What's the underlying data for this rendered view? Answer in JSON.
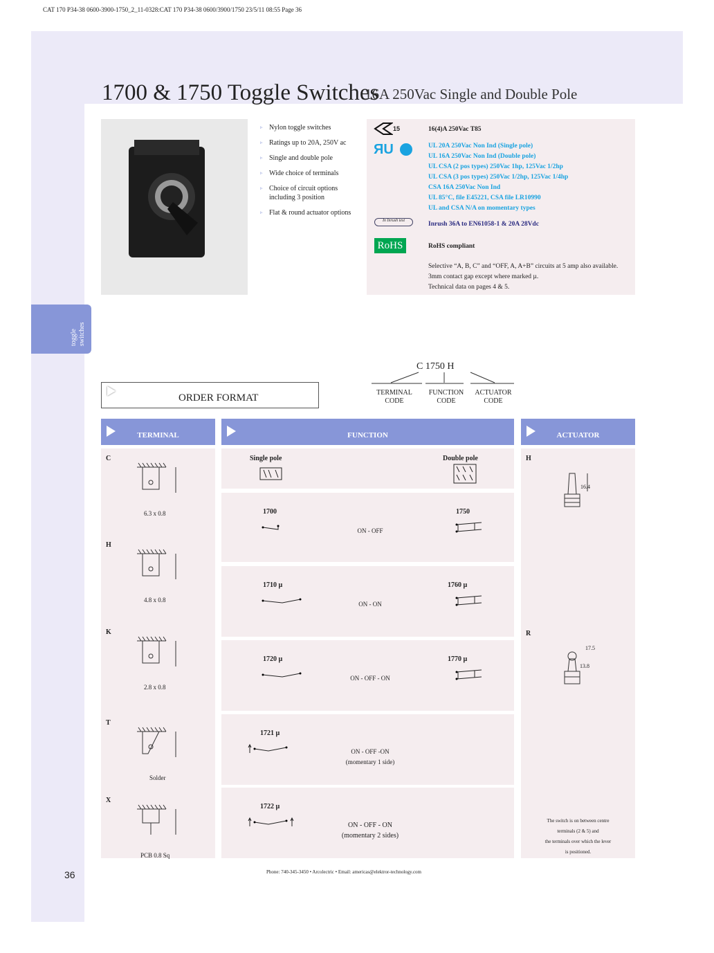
{
  "slug": "CAT 170 P34-38 0600-3900-1750_2_11-0328:CAT 170 P34-38 0600/3900/1750  23/5/11  08:55  Page 36",
  "title": "1700 & 1750 Toggle Switches",
  "subtitle": "16A 250Vac Single and Double Pole",
  "side_tab": [
    "toggle",
    "switches"
  ],
  "features": [
    "Nylon toggle switches",
    "Ratings up to 20A, 250V ac",
    "Single and double pole",
    "Wide choice of terminals",
    "Choice of circuit options including 3 position",
    "Flat & round actuator options"
  ],
  "certs": {
    "enec_num": "15",
    "enec": "16(4)A 250Vac  T85",
    "ul_lines": [
      "UL 20A 250Vac Non Ind (Single pole)",
      "UL 16A 250Vac Non Ind (Double pole)",
      "UL CSA (2 pos types) 250Vac 1hp, 125Vac 1/2hp",
      "UL CSA (3 pos types) 250Vac 1/2hp, 125Vac 1/4hp",
      "CSA 16A 250Vac Non Ind",
      "UL 85°C, file E45221, CSA file LR10990",
      "UL and CSA N/A on momentary types"
    ],
    "inrush_badge": "In Inrush test",
    "inrush": "Inrush 36A to EN61058-1 & 20A 28Vdc",
    "rohs_badge": "RoHS",
    "rohs": "RoHS compliant",
    "notes": [
      "Selective “A, B, C” and “OFF, A, A+B” circuits at 5 amp also available.",
      "3mm contact gap except where marked µ.",
      "Technical data on pages 4 & 5."
    ]
  },
  "order_format": {
    "label": "ORDER FORMAT",
    "code": "C 1750 H",
    "parts": [
      [
        "TERMINAL",
        "CODE"
      ],
      [
        "FUNCTION",
        "CODE"
      ],
      [
        "ACTUATOR",
        "CODE"
      ]
    ]
  },
  "headers": {
    "terminal": "TERMINAL",
    "function": "FUNCTION",
    "actuator": "ACTUATOR"
  },
  "terminals": [
    {
      "code": "C",
      "size": "6.3 x 0.8"
    },
    {
      "code": "H",
      "size": "4.8 x 0.8"
    },
    {
      "code": "K",
      "size": "2.8 x 0.8"
    },
    {
      "code": "T",
      "size": "Solder"
    },
    {
      "code": "X",
      "size": "PCB 0.8 Sq"
    }
  ],
  "function": {
    "single": "Single pole",
    "double": "Double pole",
    "rows": [
      {
        "sp": "1700",
        "dp": "1750",
        "desc": "ON - OFF",
        "sub": ""
      },
      {
        "sp": "1710 µ",
        "dp": "1760 µ",
        "desc": "ON - ON",
        "sub": ""
      },
      {
        "sp": "1720 µ",
        "dp": "1770 µ",
        "desc": "ON - OFF - ON",
        "sub": ""
      },
      {
        "sp": "1721 µ",
        "dp": "",
        "desc": "ON - OFF -ON",
        "sub": "(momentary 1 side)"
      },
      {
        "sp": "1722 µ",
        "dp": "",
        "desc": "ON - OFF - ON",
        "sub": "(momentary 2 sides)"
      }
    ]
  },
  "actuators": [
    {
      "code": "H",
      "dims": [
        "16.4"
      ]
    },
    {
      "code": "R",
      "dims": [
        "17.5",
        "13.8"
      ]
    }
  ],
  "actuator_note": [
    "The switch is on between centre",
    "terminals (2 & 5) and",
    "the terminals over which the lever",
    "is positioned."
  ],
  "footer": "Phone: 740-345-3450 • Arcolectric • Email: americas@elektror-technology.com",
  "page_number": "36",
  "colors": {
    "header": "#8796d8",
    "panel": "#f5edef",
    "band": "#eceaf8",
    "ul_blue": "#1aa3e0",
    "rohs_green": "#00a651"
  }
}
